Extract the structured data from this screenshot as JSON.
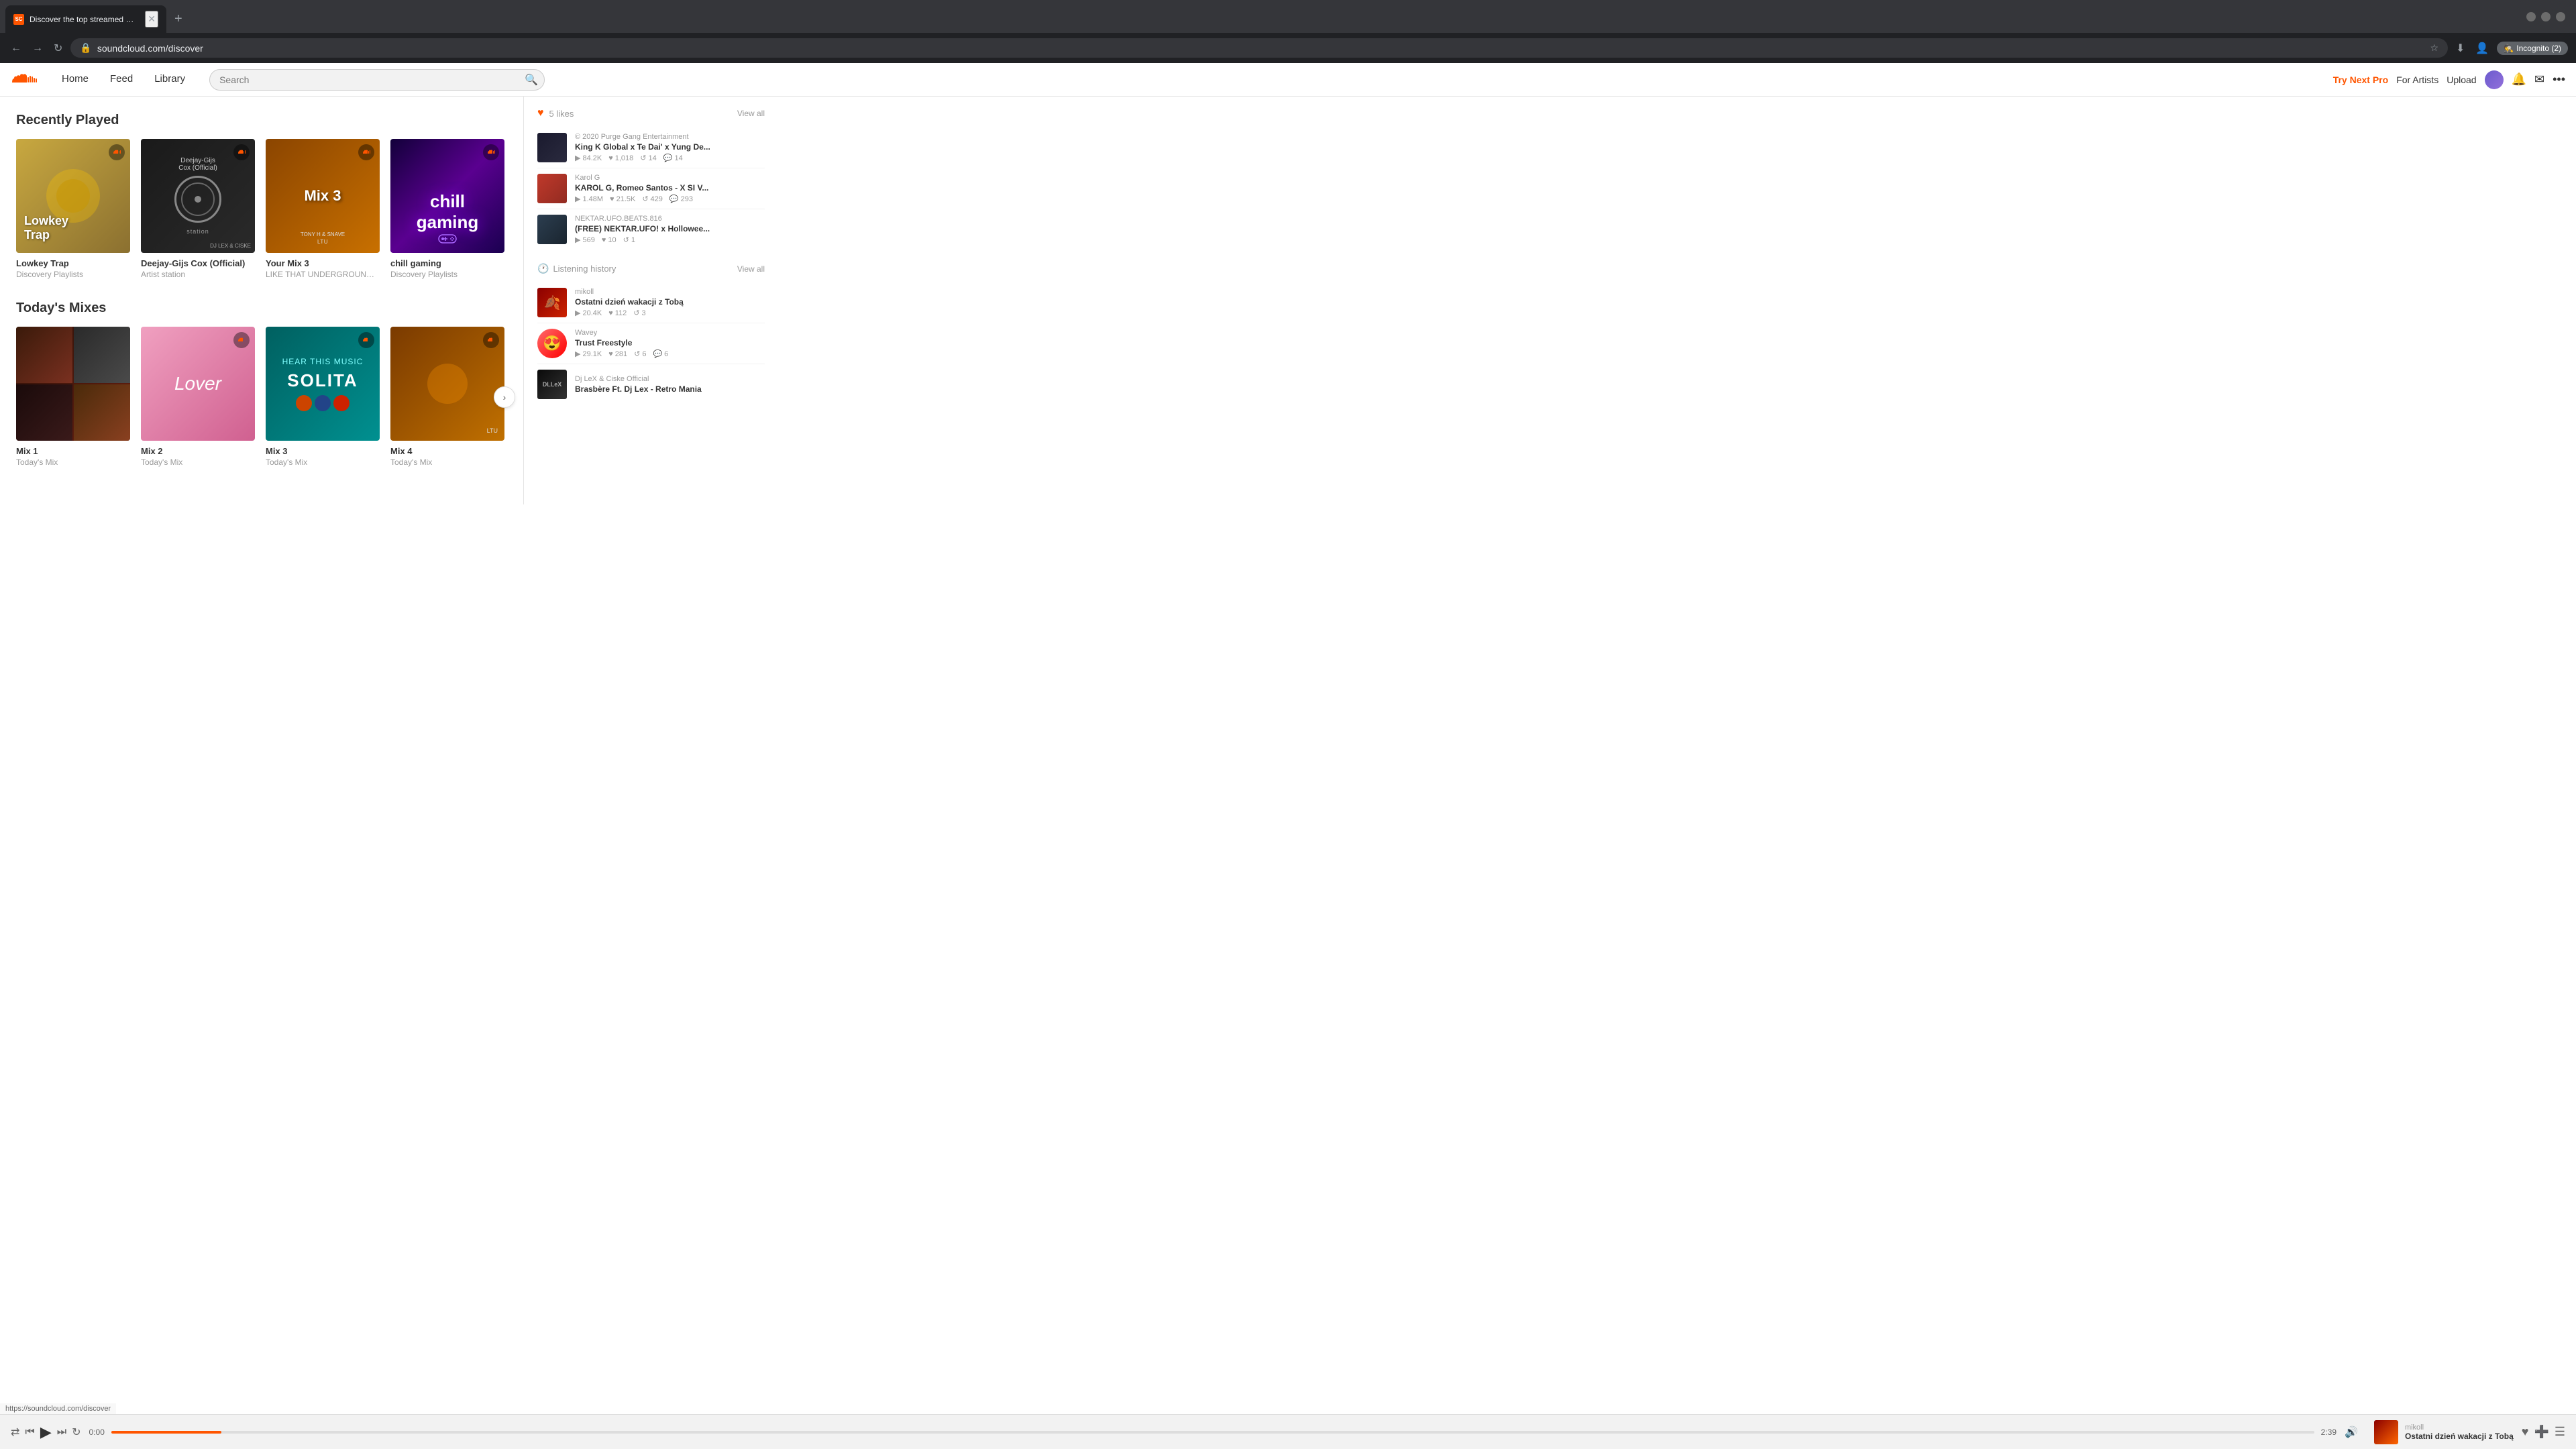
{
  "browser": {
    "tab_title": "Discover the top streamed mus...",
    "url": "soundcloud.com/discover",
    "incognito_text": "Incognito (2)"
  },
  "header": {
    "logo_text": "SoundCloud",
    "nav": {
      "home": "Home",
      "feed": "Feed",
      "library": "Library"
    },
    "search_placeholder": "Search",
    "try_next_pro": "Try Next Pro",
    "for_artists": "For Artists",
    "upload": "Upload"
  },
  "recently_played": {
    "section_title": "Recently Played",
    "cards": [
      {
        "title": "Lowkey Trap",
        "sub": "Discovery Playlists",
        "type": "lowkey"
      },
      {
        "title": "Deejay-Gijs Cox (Official)",
        "sub": "Artist station",
        "type": "dj"
      },
      {
        "title": "Your Mix 3",
        "sub": "LIKE THAT UNDERGROUND ...",
        "type": "mix3"
      },
      {
        "title": "chill gaming",
        "sub": "Discovery Playlists",
        "type": "chill"
      }
    ]
  },
  "todays_mixes": {
    "section_title": "Today's Mixes",
    "cards": [
      {
        "type": "t1"
      },
      {
        "type": "t2"
      },
      {
        "type": "t3",
        "label": "SOLITA"
      },
      {
        "type": "t4"
      },
      {
        "type": "t5"
      }
    ]
  },
  "sidebar": {
    "likes": {
      "count": "5 likes",
      "view_all": "View all"
    },
    "tracks": [
      {
        "artist": "© 2020 Purge Gang Entertainment",
        "title": "King K Global x Te Dai' x Yung De...",
        "plays": "84.2K",
        "likes": "1,018",
        "reposts": "14",
        "comments": "14"
      },
      {
        "artist": "Karol G",
        "title": "KAROL G, Romeo Santos - X SI V...",
        "plays": "1.48M",
        "likes": "21.5K",
        "reposts": "429",
        "comments": "293"
      },
      {
        "artist": "NEKTAR.UFO.BEATS.816",
        "title": "(FREE) NEKTAR.UFO! x Hollowee...",
        "plays": "569",
        "likes": "10",
        "reposts": "1",
        "comments": ""
      }
    ],
    "listening_history": {
      "label": "Listening history",
      "view_all": "View all"
    },
    "history_tracks": [
      {
        "artist": "mikoll",
        "title": "Ostatni dzień wakacji z Tobą",
        "plays": "20.4K",
        "likes": "112",
        "reposts": "3"
      },
      {
        "artist": "Wavey",
        "title": "Trust Freestyle",
        "plays": "29.1K",
        "likes": "281",
        "reposts": "6",
        "comments": "6",
        "emoji": "😍"
      },
      {
        "artist": "Dj LeX & Ciske Official",
        "title": "Brasbère Ft. Dj Lex - Retro Mania",
        "plays": "...",
        "likes": "...",
        "reposts": "..."
      }
    ]
  },
  "player": {
    "time_current": "0:00",
    "time_total": "2:39",
    "artist": "mikoll",
    "title": "Ostatni dzień wakacji z Tobą"
  },
  "status_bar": {
    "url": "https://soundcloud.com/discover"
  }
}
